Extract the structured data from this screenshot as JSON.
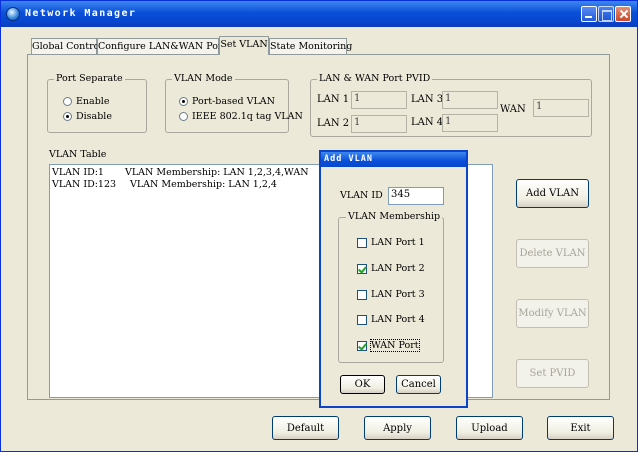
{
  "window": {
    "title": "Network Manager"
  },
  "tabs": [
    {
      "label": "Global Control"
    },
    {
      "label": "Configure LAN&WAN Port"
    },
    {
      "label": "Set VLAN"
    },
    {
      "label": "State Monitoring"
    }
  ],
  "port_separate": {
    "title": "Port Separate",
    "options": [
      {
        "label": "Enable",
        "selected": false
      },
      {
        "label": "Disable",
        "selected": true
      }
    ]
  },
  "vlan_mode": {
    "title": "VLAN Mode",
    "options": [
      {
        "label": "Port-based VLAN",
        "selected": true
      },
      {
        "label": "IEEE 802.1q tag VLAN",
        "selected": false
      }
    ]
  },
  "pvid": {
    "title": "LAN & WAN Port PVID",
    "lan1_label": "LAN 1",
    "lan1_value": "1",
    "lan2_label": "LAN 2",
    "lan2_value": "1",
    "lan3_label": "LAN 3",
    "lan3_value": "1",
    "lan4_label": "LAN 4",
    "lan4_value": "1",
    "wan_label": "WAN",
    "wan_value": "1"
  },
  "vlan_table": {
    "title": "VLAN Table",
    "rows": [
      {
        "id": "VLAN ID:1",
        "membership": "VLAN Membership:  LAN 1,2,3,4,WAN"
      },
      {
        "id": "VLAN ID:123",
        "membership": "VLAN Membership:  LAN 1,2,4"
      }
    ]
  },
  "side_buttons": {
    "add": "Add VLAN",
    "delete": "Delete VLAN",
    "modify": "Modify VLAN",
    "set_pvid": "Set PVID"
  },
  "bottom_buttons": {
    "default": "Default",
    "apply": "Apply",
    "upload": "Upload",
    "exit": "Exit"
  },
  "dialog": {
    "title": "Add VLAN",
    "vlan_id_label": "VLAN ID",
    "vlan_id_value": "345",
    "membership_title": "VLAN Membership",
    "ports": [
      {
        "label": "LAN Port 1",
        "checked": false
      },
      {
        "label": "LAN Port 2",
        "checked": true
      },
      {
        "label": "LAN Port 3",
        "checked": false
      },
      {
        "label": "LAN Port 4",
        "checked": false
      },
      {
        "label": "WAN Port",
        "checked": true
      }
    ],
    "ok": "OK",
    "cancel": "Cancel"
  }
}
